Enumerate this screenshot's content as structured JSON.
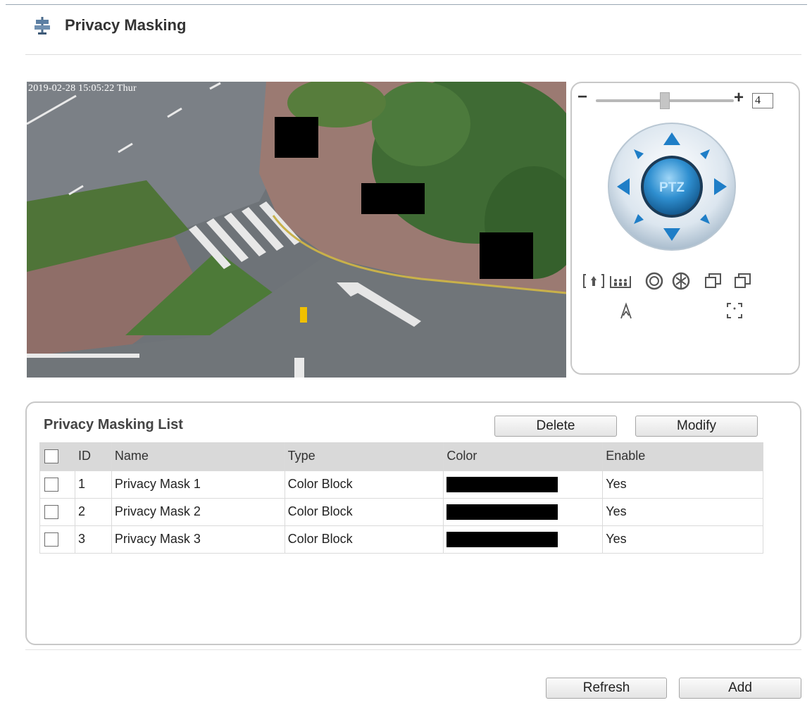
{
  "page": {
    "title": "Privacy Masking",
    "title_icon": "privacy-sign-icon"
  },
  "video": {
    "osd_timestamp": "2019-02-28 15:05:22 Thur"
  },
  "ptz": {
    "zoom_minus": "−",
    "zoom_plus": "+",
    "speed_value": "4",
    "speed_level_fraction": 0.5,
    "center_label": "PTZ",
    "tools": [
      "zoom-in-icon",
      "zoom-out-icon",
      "focus-near-icon",
      "focus-far-icon",
      "iris-open-icon",
      "iris-close-icon",
      "auto-focus-icon",
      "one-key-focus-icon"
    ]
  },
  "list": {
    "title": "Privacy Masking List",
    "delete_label": "Delete",
    "modify_label": "Modify",
    "columns": [
      "",
      "ID",
      "Name",
      "Type",
      "Color",
      "Enable"
    ],
    "rows": [
      {
        "id": "1",
        "name": "Privacy Mask 1",
        "type": "Color Block",
        "color": "#000000",
        "enable": "Yes"
      },
      {
        "id": "2",
        "name": "Privacy Mask 2",
        "type": "Color Block",
        "color": "#000000",
        "enable": "Yes"
      },
      {
        "id": "3",
        "name": "Privacy Mask 3",
        "type": "Color Block",
        "color": "#000000",
        "enable": "Yes"
      }
    ]
  },
  "footer": {
    "refresh_label": "Refresh",
    "add_label": "Add"
  }
}
